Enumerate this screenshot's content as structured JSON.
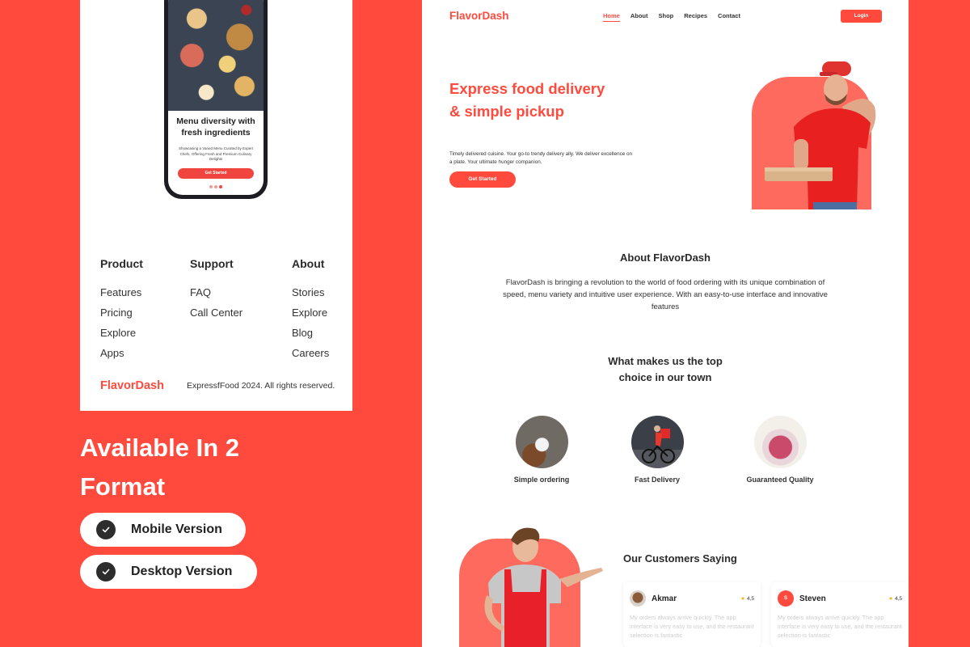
{
  "colors": {
    "brand": "#FF4A3D",
    "brand_soft": "#FF6A5E",
    "text_dark": "#2b2b2b",
    "star": "#F5B400"
  },
  "mobile": {
    "phone": {
      "title": "Menu diversity with fresh ingredients",
      "description": "Showcasing a Varied Menu Curated by Expert Chefs, Offering Fresh and Premium Culinary Delights",
      "cta_label": "Get Started",
      "carousel": {
        "total": 3,
        "active": 3
      }
    },
    "footer": {
      "columns": [
        {
          "title": "Product",
          "links": [
            "Features",
            "Pricing",
            "Explore",
            "Apps"
          ]
        },
        {
          "title": "Support",
          "links": [
            "FAQ",
            "Call Center"
          ]
        },
        {
          "title": "About",
          "links": [
            "Stories",
            "Explore",
            "Blog",
            "Careers"
          ]
        }
      ],
      "brand": "FlavorDash",
      "copyright": "ExpressfFood 2024. All rights reserved."
    }
  },
  "formats": {
    "title": "Available In 2 Format",
    "items": [
      {
        "icon": "check-icon",
        "label": "Mobile Version"
      },
      {
        "icon": "check-icon",
        "label": "Desktop Version"
      }
    ]
  },
  "desktop": {
    "nav": {
      "brand": "FlavorDash",
      "links": [
        "Home",
        "About",
        "Shop",
        "Recipes",
        "Contact"
      ],
      "active_link": "Home",
      "login_label": "Login"
    },
    "hero": {
      "title": "Express food delivery & simple pickup",
      "description": "Timely delivered cuisine. Your go-to trendy delivery ally. We deliver excellence on a plate. Your ultimate hunger companion.",
      "cta_label": "Get Started",
      "image": "delivery-man-with-pizza-box"
    },
    "about": {
      "title": "About FlavorDash",
      "text": "FlavorDash is bringing a revolution to the world of food ordering with its unique combination of speed, menu variety and intuitive user experience. With an easy-to-use interface and innovative features"
    },
    "why": {
      "title_line1": "What makes us the top",
      "title_line2": "choice in our town",
      "features": [
        {
          "label": "Simple ordering",
          "image": "phone-ordering-photo"
        },
        {
          "label": "Fast Delivery",
          "image": "bike-courier-photo"
        },
        {
          "label": "Guaranteed Quality",
          "image": "quality-stamp-photo"
        }
      ]
    },
    "reviews": {
      "title": "Our Customers Saying",
      "image": "chef-in-apron",
      "items": [
        {
          "name": "Akmar",
          "avatar": "photo",
          "initial": "",
          "rating": "4,5",
          "text": "My orders always arrive quickly. The app interface is very easy to use, and the restaurant selection is fantastic"
        },
        {
          "name": "Steven",
          "avatar": "letter",
          "initial": "S",
          "rating": "4,5",
          "text": "My orders always arrive quickly. The app interface is very easy to use, and the restaurant selection is fantastic"
        }
      ]
    }
  }
}
